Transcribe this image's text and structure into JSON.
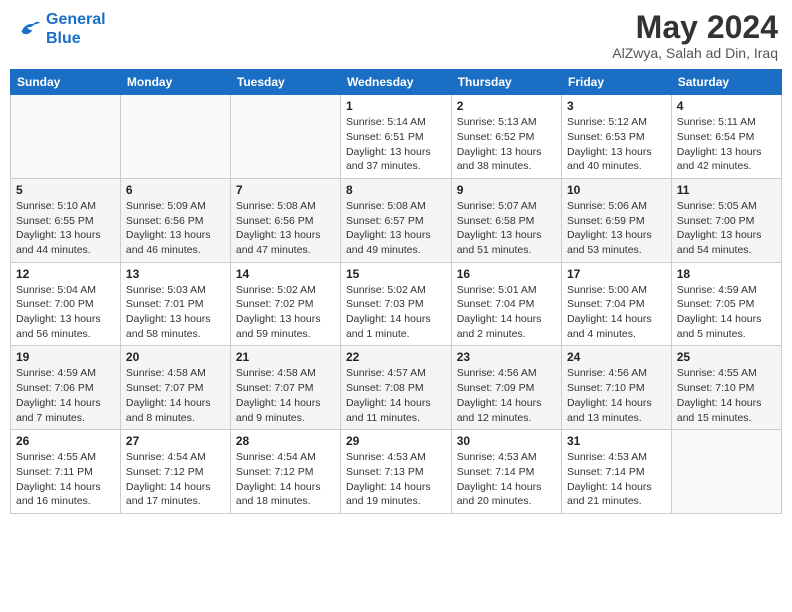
{
  "header": {
    "logo_line1": "General",
    "logo_line2": "Blue",
    "title": "May 2024",
    "location": "AlZwya, Salah ad Din, Iraq"
  },
  "days_of_week": [
    "Sunday",
    "Monday",
    "Tuesday",
    "Wednesday",
    "Thursday",
    "Friday",
    "Saturday"
  ],
  "weeks": [
    [
      {
        "day": "",
        "info": ""
      },
      {
        "day": "",
        "info": ""
      },
      {
        "day": "",
        "info": ""
      },
      {
        "day": "1",
        "info": "Sunrise: 5:14 AM\nSunset: 6:51 PM\nDaylight: 13 hours and 37 minutes."
      },
      {
        "day": "2",
        "info": "Sunrise: 5:13 AM\nSunset: 6:52 PM\nDaylight: 13 hours and 38 minutes."
      },
      {
        "day": "3",
        "info": "Sunrise: 5:12 AM\nSunset: 6:53 PM\nDaylight: 13 hours and 40 minutes."
      },
      {
        "day": "4",
        "info": "Sunrise: 5:11 AM\nSunset: 6:54 PM\nDaylight: 13 hours and 42 minutes."
      }
    ],
    [
      {
        "day": "5",
        "info": "Sunrise: 5:10 AM\nSunset: 6:55 PM\nDaylight: 13 hours and 44 minutes."
      },
      {
        "day": "6",
        "info": "Sunrise: 5:09 AM\nSunset: 6:56 PM\nDaylight: 13 hours and 46 minutes."
      },
      {
        "day": "7",
        "info": "Sunrise: 5:08 AM\nSunset: 6:56 PM\nDaylight: 13 hours and 47 minutes."
      },
      {
        "day": "8",
        "info": "Sunrise: 5:08 AM\nSunset: 6:57 PM\nDaylight: 13 hours and 49 minutes."
      },
      {
        "day": "9",
        "info": "Sunrise: 5:07 AM\nSunset: 6:58 PM\nDaylight: 13 hours and 51 minutes."
      },
      {
        "day": "10",
        "info": "Sunrise: 5:06 AM\nSunset: 6:59 PM\nDaylight: 13 hours and 53 minutes."
      },
      {
        "day": "11",
        "info": "Sunrise: 5:05 AM\nSunset: 7:00 PM\nDaylight: 13 hours and 54 minutes."
      }
    ],
    [
      {
        "day": "12",
        "info": "Sunrise: 5:04 AM\nSunset: 7:00 PM\nDaylight: 13 hours and 56 minutes."
      },
      {
        "day": "13",
        "info": "Sunrise: 5:03 AM\nSunset: 7:01 PM\nDaylight: 13 hours and 58 minutes."
      },
      {
        "day": "14",
        "info": "Sunrise: 5:02 AM\nSunset: 7:02 PM\nDaylight: 13 hours and 59 minutes."
      },
      {
        "day": "15",
        "info": "Sunrise: 5:02 AM\nSunset: 7:03 PM\nDaylight: 14 hours and 1 minute."
      },
      {
        "day": "16",
        "info": "Sunrise: 5:01 AM\nSunset: 7:04 PM\nDaylight: 14 hours and 2 minutes."
      },
      {
        "day": "17",
        "info": "Sunrise: 5:00 AM\nSunset: 7:04 PM\nDaylight: 14 hours and 4 minutes."
      },
      {
        "day": "18",
        "info": "Sunrise: 4:59 AM\nSunset: 7:05 PM\nDaylight: 14 hours and 5 minutes."
      }
    ],
    [
      {
        "day": "19",
        "info": "Sunrise: 4:59 AM\nSunset: 7:06 PM\nDaylight: 14 hours and 7 minutes."
      },
      {
        "day": "20",
        "info": "Sunrise: 4:58 AM\nSunset: 7:07 PM\nDaylight: 14 hours and 8 minutes."
      },
      {
        "day": "21",
        "info": "Sunrise: 4:58 AM\nSunset: 7:07 PM\nDaylight: 14 hours and 9 minutes."
      },
      {
        "day": "22",
        "info": "Sunrise: 4:57 AM\nSunset: 7:08 PM\nDaylight: 14 hours and 11 minutes."
      },
      {
        "day": "23",
        "info": "Sunrise: 4:56 AM\nSunset: 7:09 PM\nDaylight: 14 hours and 12 minutes."
      },
      {
        "day": "24",
        "info": "Sunrise: 4:56 AM\nSunset: 7:10 PM\nDaylight: 14 hours and 13 minutes."
      },
      {
        "day": "25",
        "info": "Sunrise: 4:55 AM\nSunset: 7:10 PM\nDaylight: 14 hours and 15 minutes."
      }
    ],
    [
      {
        "day": "26",
        "info": "Sunrise: 4:55 AM\nSunset: 7:11 PM\nDaylight: 14 hours and 16 minutes."
      },
      {
        "day": "27",
        "info": "Sunrise: 4:54 AM\nSunset: 7:12 PM\nDaylight: 14 hours and 17 minutes."
      },
      {
        "day": "28",
        "info": "Sunrise: 4:54 AM\nSunset: 7:12 PM\nDaylight: 14 hours and 18 minutes."
      },
      {
        "day": "29",
        "info": "Sunrise: 4:53 AM\nSunset: 7:13 PM\nDaylight: 14 hours and 19 minutes."
      },
      {
        "day": "30",
        "info": "Sunrise: 4:53 AM\nSunset: 7:14 PM\nDaylight: 14 hours and 20 minutes."
      },
      {
        "day": "31",
        "info": "Sunrise: 4:53 AM\nSunset: 7:14 PM\nDaylight: 14 hours and 21 minutes."
      },
      {
        "day": "",
        "info": ""
      }
    ]
  ]
}
